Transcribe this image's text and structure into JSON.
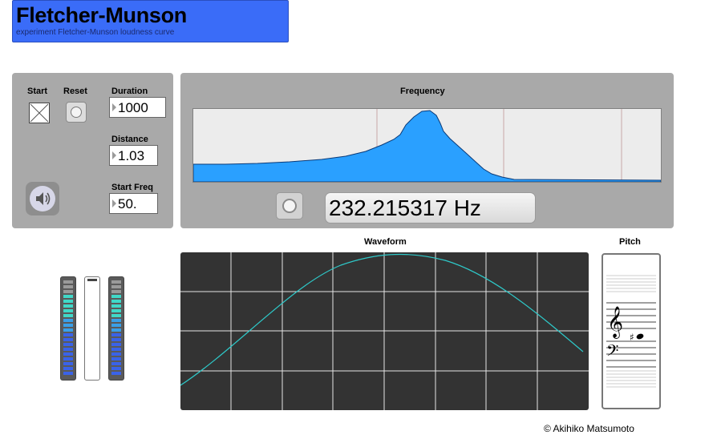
{
  "header": {
    "title": "Fletcher-Munson",
    "subtitle": "experiment Fletcher-Munson loudness curve"
  },
  "controls": {
    "start_label": "Start",
    "reset_label": "Reset",
    "duration_label": "Duration",
    "duration_value": "1000",
    "distance_label": "Distance",
    "distance_value": "1.03",
    "start_freq_label": "Start Freq",
    "start_freq_value": "50.",
    "speaker_icon": "speaker-icon"
  },
  "frequency": {
    "title": "Frequency",
    "readout": "232.215317 Hz",
    "fill_color": "#2aa0ff"
  },
  "waveform": {
    "title": "Waveform",
    "trace_color": "#2ec9c9",
    "background": "#333333"
  },
  "pitch": {
    "title": "Pitch",
    "clefs": [
      "treble-clef-icon",
      "bass-clef-icon"
    ],
    "accidental": "sharp"
  },
  "footer": {
    "copyright": "© Akihiko Matsumoto"
  },
  "colors": {
    "title_bar": "#3a6cf8",
    "panel": "#a9a9a9",
    "meter_low": "#3a63e8",
    "meter_mid": "#40d8c8"
  }
}
